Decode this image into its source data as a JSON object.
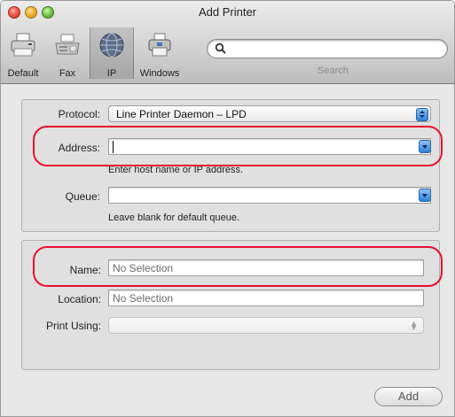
{
  "window": {
    "title": "Add Printer"
  },
  "toolbar": {
    "items": [
      {
        "label": "Default",
        "icon": "default-printer-icon"
      },
      {
        "label": "Fax",
        "icon": "fax-icon"
      },
      {
        "label": "IP",
        "icon": "globe-icon",
        "selected": true
      },
      {
        "label": "Windows",
        "icon": "windows-printer-icon"
      }
    ],
    "search": {
      "label": "Search",
      "value": "",
      "icon": "magnifier-icon"
    }
  },
  "form": {
    "protocol": {
      "label": "Protocol:",
      "value": "Line Printer Daemon – LPD"
    },
    "address": {
      "label": "Address:",
      "value": "",
      "hint": "Enter host name or IP address."
    },
    "queue": {
      "label": "Queue:",
      "value": "",
      "hint": "Leave blank for default queue."
    },
    "name": {
      "label": "Name:",
      "value": "No Selection"
    },
    "location": {
      "label": "Location:",
      "value": "No Selection"
    },
    "print_using": {
      "label": "Print Using:",
      "value": ""
    }
  },
  "actions": {
    "add_label": "Add"
  },
  "colors": {
    "highlight": "#e8102c",
    "accent": "#2f7fd8"
  }
}
